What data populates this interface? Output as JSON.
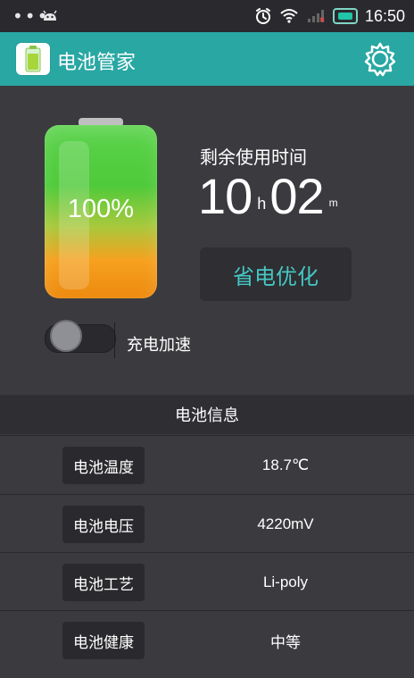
{
  "status_bar": {
    "dots": "•••",
    "time": "16:50"
  },
  "app": {
    "title": "电池管家"
  },
  "hero": {
    "battery_percent_label": "100%",
    "battery_level": 1.0,
    "remaining_label": "剩余使用时间",
    "hours": "10",
    "hours_unit": "h",
    "minutes": "02",
    "minutes_unit": "m",
    "optimize_button": "省电优化",
    "charge_boost_label": "充电加速",
    "charge_boost_on": false
  },
  "info": {
    "title": "电池信息",
    "rows": [
      {
        "label": "电池温度",
        "value": "18.7℃"
      },
      {
        "label": "电池电压",
        "value": "4220mV"
      },
      {
        "label": "电池工艺",
        "value": "Li-poly"
      },
      {
        "label": "电池健康",
        "value": "中等"
      }
    ]
  },
  "colors": {
    "accent": "#29a7a3",
    "button_text": "#45c7c3",
    "background": "#3a3a3f"
  }
}
